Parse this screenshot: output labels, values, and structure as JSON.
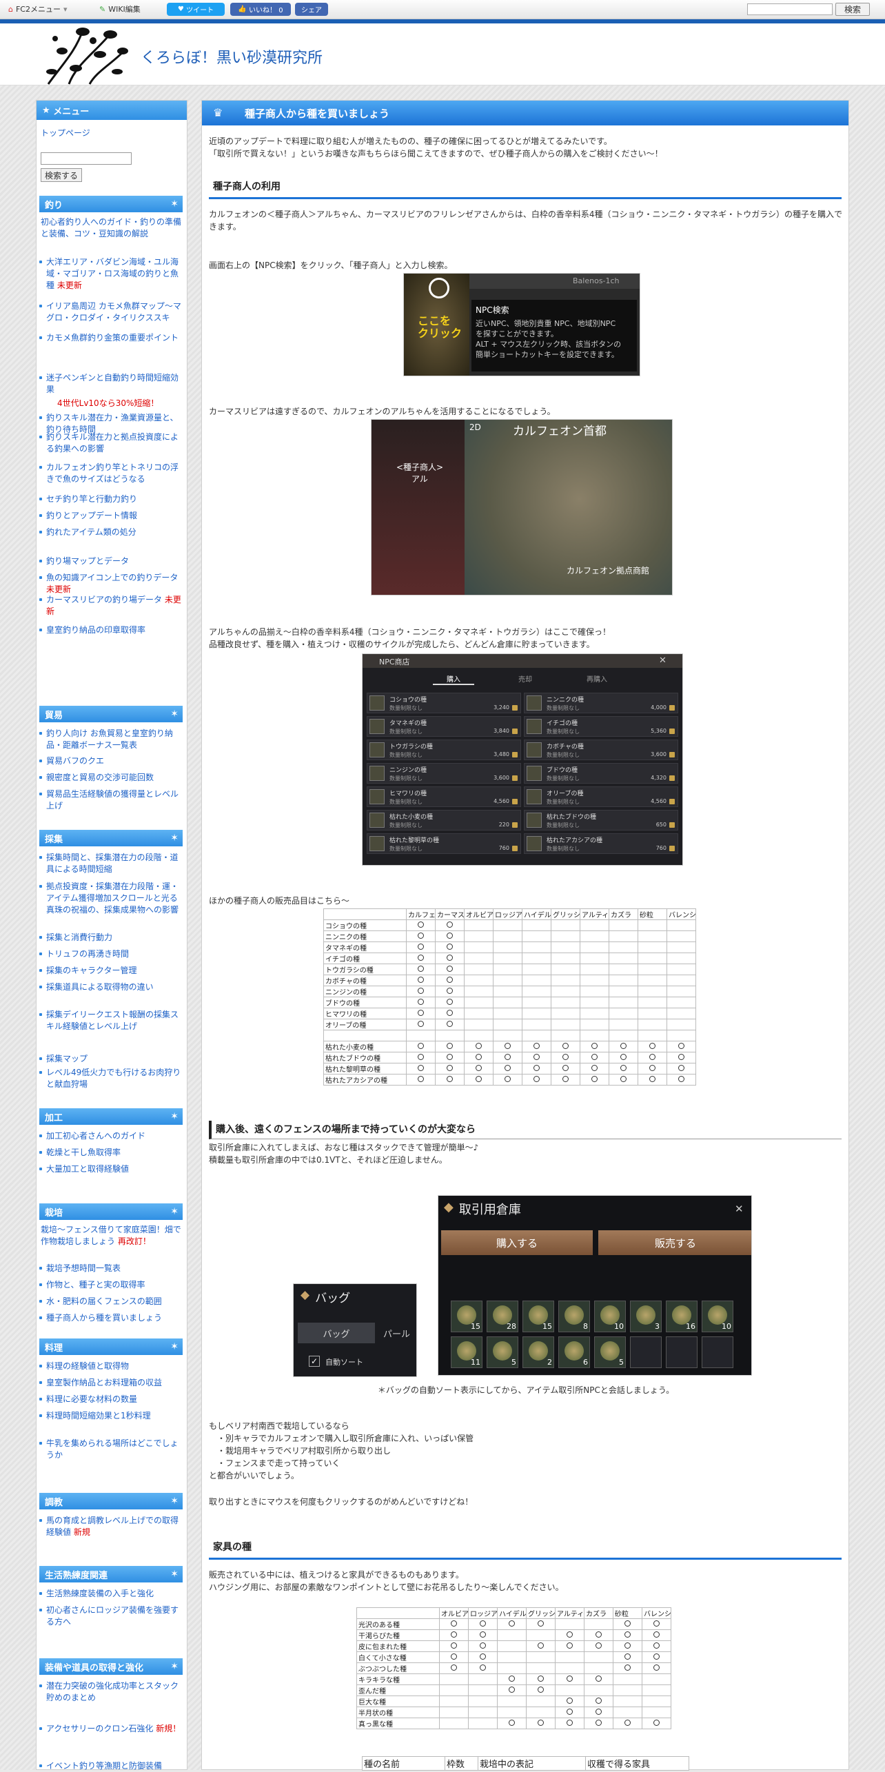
{
  "topbar": {
    "fc2": "FC2メニュー",
    "wiki": "WIKI編集",
    "tweet": "ツイート",
    "like": "いいね！ 0",
    "share": "シェア",
    "search_btn": "検索"
  },
  "site": {
    "title": "くろらぼ！黒い砂漠研究所"
  },
  "sidebar": {
    "menu": "メニュー",
    "top": "トップページ",
    "search_btn": "検索する",
    "fishing": {
      "title": "釣り",
      "intro": "初心者釣り人へのガイド・釣りの準備と装備、コツ・豆知識の解説",
      "items": [
        "大洋エリア・バダビン海域・ユル海域・マゴリア・ロス海域の釣りと魚種",
        "イリア島周辺 カモメ魚群マップ～マグロ・クロダイ・タイリクススキ",
        "カモメ魚群釣り金策の重要ポイント",
        "迷子ペンギンと自動釣り時間短縮効果",
        "釣りスキル潜在力・漁業資源量と、釣り待ち時間",
        "釣りスキル潜在力と拠点投資度による釣果への影響",
        "カルフェオン釣り竿とトネリコの浮きで魚のサイズはどうなる",
        "セチ釣り竿と行動力釣り",
        "釣りとアップデート情報",
        "釣れたアイテム類の処分",
        "釣り場マップとデータ",
        "魚の知識アイコン上での釣りデータ",
        "カーマスリビアの釣り場データ",
        "皇室釣り納品の印章取得率"
      ],
      "new1": "未更新",
      "penguin_note": "4世代Lv10なら30%短縮！",
      "new2": "未更新",
      "new3": "未更新"
    },
    "trade": {
      "title": "貿易",
      "items": [
        "釣り人向け お魚貿易と皇室釣り納品・距離ボーナス一覧表",
        "貿易バフのクエ",
        "親密度と貿易の交渉可能回数",
        "貿易品生活経験値の獲得量とレベル上げ"
      ]
    },
    "gather": {
      "title": "採集",
      "items": [
        "採集時間と、採集潜在力の段階・道具による時間短縮",
        "拠点投資度・採集潜在力段階・運・アイテム獲得増加スクロールと光る真珠の祝福の、採集成果物への影響",
        "採集と消費行動力",
        "トリュフの再湧き時間",
        "採集のキャラクター管理",
        "採集道具による取得物の違い",
        "採集デイリークエスト報酬の採集スキル経験値とレベル上げ",
        "採集マップ",
        "レベル49低火力でも行けるお肉狩りと献血狩場"
      ]
    },
    "process": {
      "title": "加工",
      "items": [
        "加工初心者さんへのガイド",
        "乾燥と干し魚取得率",
        "大量加工と取得経験値"
      ]
    },
    "farm": {
      "title": "栽培",
      "intro": "栽培～フェンス借りて家庭菜園！畑で作物栽培しましょう",
      "intro_new": "再改訂！",
      "items": [
        "栽培予想時間一覧表",
        "作物と、種子と実の取得率",
        "水・肥料の届くフェンスの範囲",
        "種子商人から種を買いましょう"
      ]
    },
    "cook": {
      "title": "料理",
      "items": [
        "料理の経験値と取得物",
        "皇室製作納品とお料理箱の収益",
        "料理に必要な材料の数量",
        "料理時間短縮効果と1秒料理",
        "牛乳を集められる場所はどこでしょうか"
      ]
    },
    "train": {
      "title": "調教",
      "items": [
        "馬の育成と調教レベル上げでの取得経験値"
      ],
      "new": "新規"
    },
    "life": {
      "title": "生活熟練度関連",
      "items": [
        "生活熟練度装備の入手と強化",
        "初心者さんにロッジア装備を強要する方へ"
      ]
    },
    "equip": {
      "title": "装備や道具の取得と強化",
      "items": [
        "潜在力突破の強化成功率とスタック貯めのまとめ",
        "アクセサリーのクロン石強化",
        "イベント釣り等漁期と防御装備"
      ],
      "new": "新規！"
    }
  },
  "content": {
    "title": "種子商人から種を買いましょう",
    "intro": "近頃のアップデートで料理に取り組む人が増えたものの、種子の確保に困ってるひとが増えてるみたいです。\n「取引所で買えない！」というお嘆きな声もちらほら聞こえてきますので、ぜひ種子商人からの購入をご検討ください～！",
    "h_use": "種子商人の利用",
    "p1": "カルフェオンの＜種子商人＞アルちゃん、カーマスリビアのフリレンゼアさんからは、白枠の香辛料系4種（コショウ・ニンニク・タマネギ・トウガラシ）の種子を購入できます。",
    "p2": "画面右上の【NPC検索】をクリック、「種子商人」と入力し検索。",
    "npc_search": {
      "server": "Balenos-1ch",
      "title": "NPC検索",
      "desc": "近いNPC、領地別貴重 NPC、地域別NPC\nを探すことができます。\nALT + マウス左クリック時、該当ボタンの\n簡単ショートカットキーを設定できます。",
      "click": "ここを\nクリック"
    },
    "p3": "カーマスリビアは遠すぎるので、カルフェオンのアルちゃんを活用することになるでしょう。",
    "map": {
      "seed": "<種子商人>\nアル",
      "city": "カルフェオン首都",
      "mode": "2D",
      "post": "カルフェオン拠点商館"
    },
    "p4": "アルちゃんの品揃え～白枠の香辛料系4種（コショウ・ニンニク・タマネギ・トウガラシ）はここで確保っ！\n品種改良せず、種を購入・植えつけ・収穫のサイクルが完成したら、どんどん倉庫に貯まっていきます。",
    "shop": {
      "title": "NPC商店",
      "tabs": [
        "購入",
        "売却",
        "再購入"
      ],
      "qty": "数量制限なし",
      "items": [
        [
          "コショウの種",
          "3,240"
        ],
        [
          "ニンニクの種",
          "4,000"
        ],
        [
          "タマネギの種",
          "3,840"
        ],
        [
          "イチゴの種",
          "5,360"
        ],
        [
          "トウガラシの種",
          "3,480"
        ],
        [
          "カボチャの種",
          "3,600"
        ],
        [
          "ニンジンの種",
          "3,600"
        ],
        [
          "ブドウの種",
          "4,320"
        ],
        [
          "ヒマワリの種",
          "4,560"
        ],
        [
          "オリーブの種",
          "4,560"
        ],
        [
          "枯れた小麦の種",
          "220"
        ],
        [
          "枯れたブドウの種",
          "650"
        ],
        [
          "枯れた黎明草の種",
          "760"
        ],
        [
          "枯れたアカシアの種",
          "760"
        ]
      ]
    },
    "p5": "ほかの種子商人の販売品目はこちら～",
    "t1": {
      "headers": [
        "カルフェ",
        "カーマス",
        "オルビア",
        "ロッジア",
        "ハイデル",
        "グリッシ",
        "アルティ",
        "カズラ",
        "砂粒",
        "バレンシ"
      ],
      "rows": [
        [
          "コショウの種",
          [
            1,
            1,
            0,
            0,
            0,
            0,
            0,
            0,
            0,
            0
          ]
        ],
        [
          "ニンニクの種",
          [
            1,
            1,
            0,
            0,
            0,
            0,
            0,
            0,
            0,
            0
          ]
        ],
        [
          "タマネギの種",
          [
            1,
            1,
            0,
            0,
            0,
            0,
            0,
            0,
            0,
            0
          ]
        ],
        [
          "イチゴの種",
          [
            1,
            1,
            0,
            0,
            0,
            0,
            0,
            0,
            0,
            0
          ]
        ],
        [
          "トウガラシの種",
          [
            1,
            1,
            0,
            0,
            0,
            0,
            0,
            0,
            0,
            0
          ]
        ],
        [
          "カボチャの種",
          [
            1,
            1,
            0,
            0,
            0,
            0,
            0,
            0,
            0,
            0
          ]
        ],
        [
          "ニンジンの種",
          [
            1,
            1,
            0,
            0,
            0,
            0,
            0,
            0,
            0,
            0
          ]
        ],
        [
          "ブドウの種",
          [
            1,
            1,
            0,
            0,
            0,
            0,
            0,
            0,
            0,
            0
          ]
        ],
        [
          "ヒマワリの種",
          [
            1,
            1,
            0,
            0,
            0,
            0,
            0,
            0,
            0,
            0
          ]
        ],
        [
          "オリーブの種",
          [
            1,
            1,
            0,
            0,
            0,
            0,
            0,
            0,
            0,
            0
          ]
        ],
        [
          "",
          [
            0,
            0,
            0,
            0,
            0,
            0,
            0,
            0,
            0,
            0
          ]
        ],
        [
          "枯れた小麦の種",
          [
            1,
            1,
            1,
            1,
            1,
            1,
            1,
            1,
            1,
            1
          ]
        ],
        [
          "枯れたブドウの種",
          [
            1,
            1,
            1,
            1,
            1,
            1,
            1,
            1,
            1,
            1
          ]
        ],
        [
          "枯れた黎明草の種",
          [
            1,
            1,
            1,
            1,
            1,
            1,
            1,
            1,
            1,
            1
          ]
        ],
        [
          "枯れたアカシアの種",
          [
            1,
            1,
            1,
            1,
            1,
            1,
            1,
            1,
            1,
            1
          ]
        ]
      ]
    },
    "h_buy": "購入後、遠くのフェンスの場所まで持っていくのが大変なら",
    "p6": "取引所倉庫に入れてしまえば、おなじ種はスタックできて管理が簡単～♪\n積載量も取引所倉庫の中では0.1VTと、それほど圧迫しません。",
    "warehouse": {
      "title": "取引用倉庫",
      "buy": "購入する",
      "sell": "販売する",
      "counts": [
        "15",
        "28",
        "15",
        "8",
        "10",
        "3",
        "16",
        "10",
        "11",
        "5",
        "2",
        "6",
        "5"
      ]
    },
    "bag": {
      "title": "バッグ",
      "tab1": "バッグ",
      "tab2": "パール",
      "autosort": "自動ソート"
    },
    "caption": "＊バッグの自動ソート表示にしてから、アイテム取引所NPCと会話しましょう。",
    "p7": "もしベリア村南西で栽培しているなら\n　・別キャラでカルフェオンで購入し取引所倉庫に入れ、いっぱい保管\n　・栽培用キャラでベリア村取引所から取り出し\n　・フェンスまで走って持っていく\nと都合がいいでしょう。",
    "p8": "取り出すときにマウスを何度もクリックするのがめんどいですけどね！",
    "h_furn": "家具の種",
    "p9": "販売されている中には、植えつけると家具ができるものもあります。\nハウジング用に、お部屋の素敵なワンポイントとして壁にお花吊るしたり～楽しんでください。",
    "t2": {
      "headers": [
        "オルビア",
        "ロッジア",
        "ハイデル",
        "グリッシ",
        "アルティ",
        "カズラ",
        "砂粒",
        "バレンシ"
      ],
      "rows": [
        [
          "光沢のある種",
          [
            1,
            1,
            1,
            1,
            0,
            0,
            1,
            1
          ]
        ],
        [
          "干渇らびた種",
          [
            1,
            1,
            0,
            0,
            1,
            1,
            1,
            1
          ]
        ],
        [
          "皮に包まれた種",
          [
            1,
            1,
            0,
            1,
            1,
            1,
            1,
            1
          ]
        ],
        [
          "白くて小さな種",
          [
            1,
            1,
            0,
            0,
            0,
            0,
            1,
            1
          ]
        ],
        [
          "ぶつぶつした種",
          [
            1,
            1,
            0,
            0,
            0,
            0,
            1,
            1
          ]
        ],
        [
          "キラキラな種",
          [
            0,
            0,
            1,
            1,
            1,
            1,
            0,
            0
          ]
        ],
        [
          "歪んだ種",
          [
            0,
            0,
            1,
            1,
            0,
            0,
            0,
            0
          ]
        ],
        [
          "巨大な種",
          [
            0,
            0,
            0,
            0,
            1,
            1,
            0,
            0
          ]
        ],
        [
          "半月状の種",
          [
            0,
            0,
            0,
            0,
            1,
            1,
            0,
            0
          ]
        ],
        [
          "真っ黒な種",
          [
            0,
            0,
            1,
            1,
            1,
            1,
            1,
            1
          ]
        ]
      ]
    },
    "t3": {
      "headers": [
        "種の名前",
        "枠数",
        "栽培中の表記",
        "収穫で得る家具"
      ]
    }
  }
}
